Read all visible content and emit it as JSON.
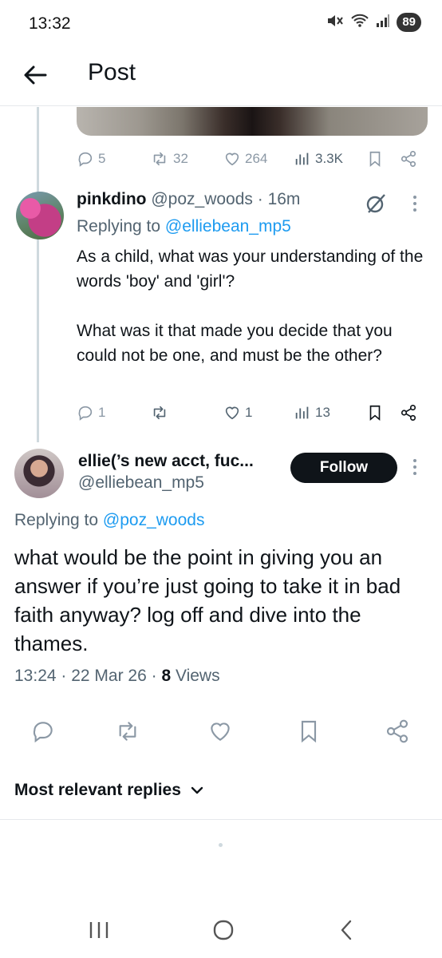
{
  "status_bar": {
    "time": "13:32",
    "battery": "89"
  },
  "header": {
    "title": "Post"
  },
  "prev_tweet": {
    "actions": {
      "replies": "5",
      "reposts": "32",
      "likes": "264",
      "views": "3.3K"
    }
  },
  "tweet1": {
    "name": "pinkdino",
    "handle_time": "@poz_woods · 16m",
    "replying_prefix": "Replying to ",
    "replying_to": "@elliebean_mp5",
    "body": "As a child, what was your understanding of the words 'boy' and 'girl'?\n\nWhat was it that made you decide that you could not be one, and must be the other?",
    "actions": {
      "replies": "1",
      "reposts": "",
      "likes": "1",
      "views": "13"
    }
  },
  "tweet2": {
    "name": "ellie(’s new acct, fuc...",
    "handle": "@elliebean_mp5",
    "follow_label": "Follow",
    "replying_prefix": "Replying to ",
    "replying_to": "@poz_woods",
    "body": "what would be the point in giving you an answer if you’re just going to take it in bad faith anyway? log off and dive into the thames.",
    "meta_time": "13:24 · 22 Mar 26 · ",
    "views_count": "8",
    "views_label": " Views"
  },
  "replies_sort": {
    "label": "Most relevant replies"
  }
}
